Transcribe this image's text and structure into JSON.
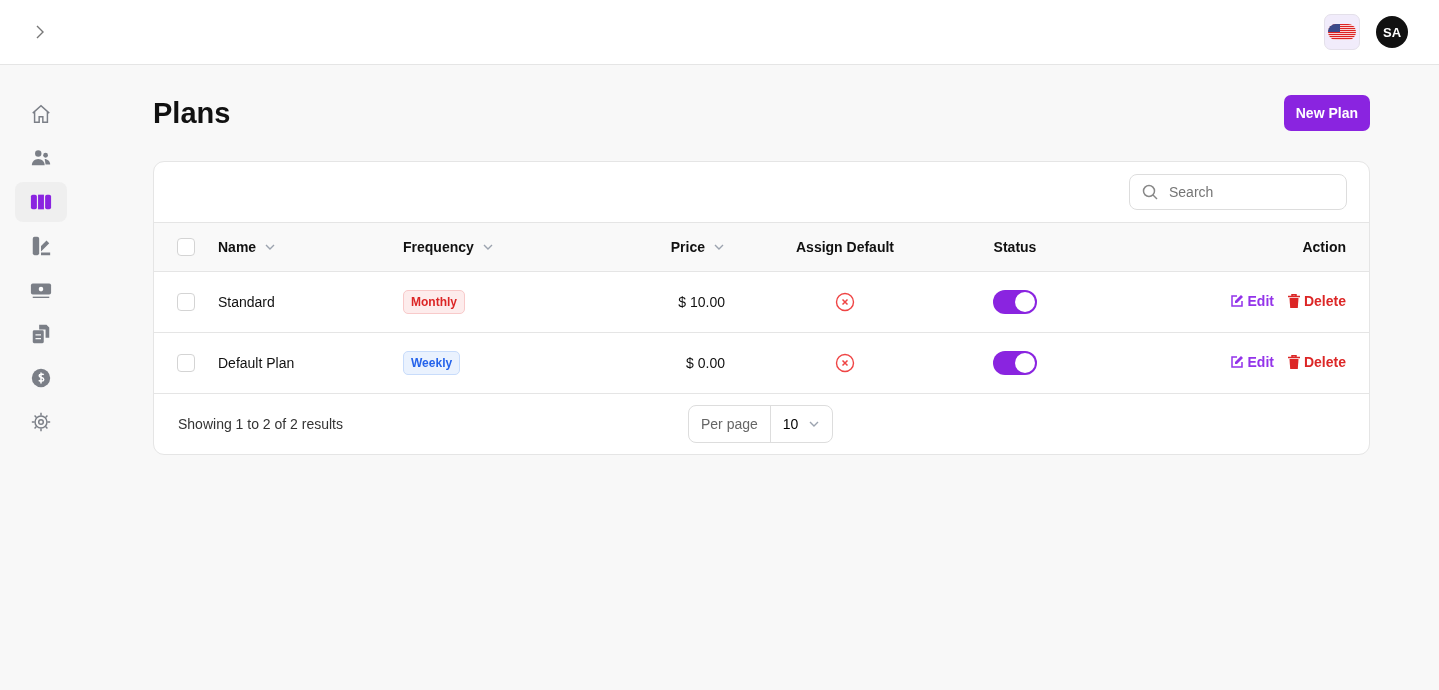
{
  "topbar": {
    "avatar": "SA"
  },
  "sidebar": {
    "items": [
      {
        "kind": "home",
        "selected": false
      },
      {
        "kind": "users",
        "selected": false
      },
      {
        "kind": "columns",
        "selected": true
      },
      {
        "kind": "swatch",
        "selected": false
      },
      {
        "kind": "money",
        "selected": false
      },
      {
        "kind": "documents",
        "selected": false
      },
      {
        "kind": "dollar",
        "selected": false
      },
      {
        "kind": "gear",
        "selected": false
      }
    ]
  },
  "page": {
    "title": "Plans",
    "new_button": "New Plan"
  },
  "search": {
    "placeholder": "Search"
  },
  "table": {
    "columns": [
      {
        "label": "Name",
        "sortable": true
      },
      {
        "label": "Frequency",
        "sortable": true
      },
      {
        "label": "Price",
        "sortable": true
      },
      {
        "label": "Assign Default",
        "sortable": false
      },
      {
        "label": "Status",
        "sortable": false
      },
      {
        "label": "Action",
        "sortable": false
      }
    ],
    "all_checked": false,
    "rows": [
      {
        "checked": false,
        "name": "Standard",
        "frequency": {
          "label": "Monthly",
          "kind": "red"
        },
        "price": "$ 10.00",
        "assign_default": false,
        "status_on": true,
        "edit": "Edit",
        "delete": "Delete"
      },
      {
        "checked": false,
        "name": "Default Plan",
        "frequency": {
          "label": "Weekly",
          "kind": "blue"
        },
        "price": "$ 0.00",
        "assign_default": false,
        "status_on": true,
        "edit": "Edit",
        "delete": "Delete"
      }
    ]
  },
  "footer": {
    "summary": "Showing 1 to 2 of 2 results",
    "per_page_label": "Per page",
    "per_page_value": "10"
  }
}
